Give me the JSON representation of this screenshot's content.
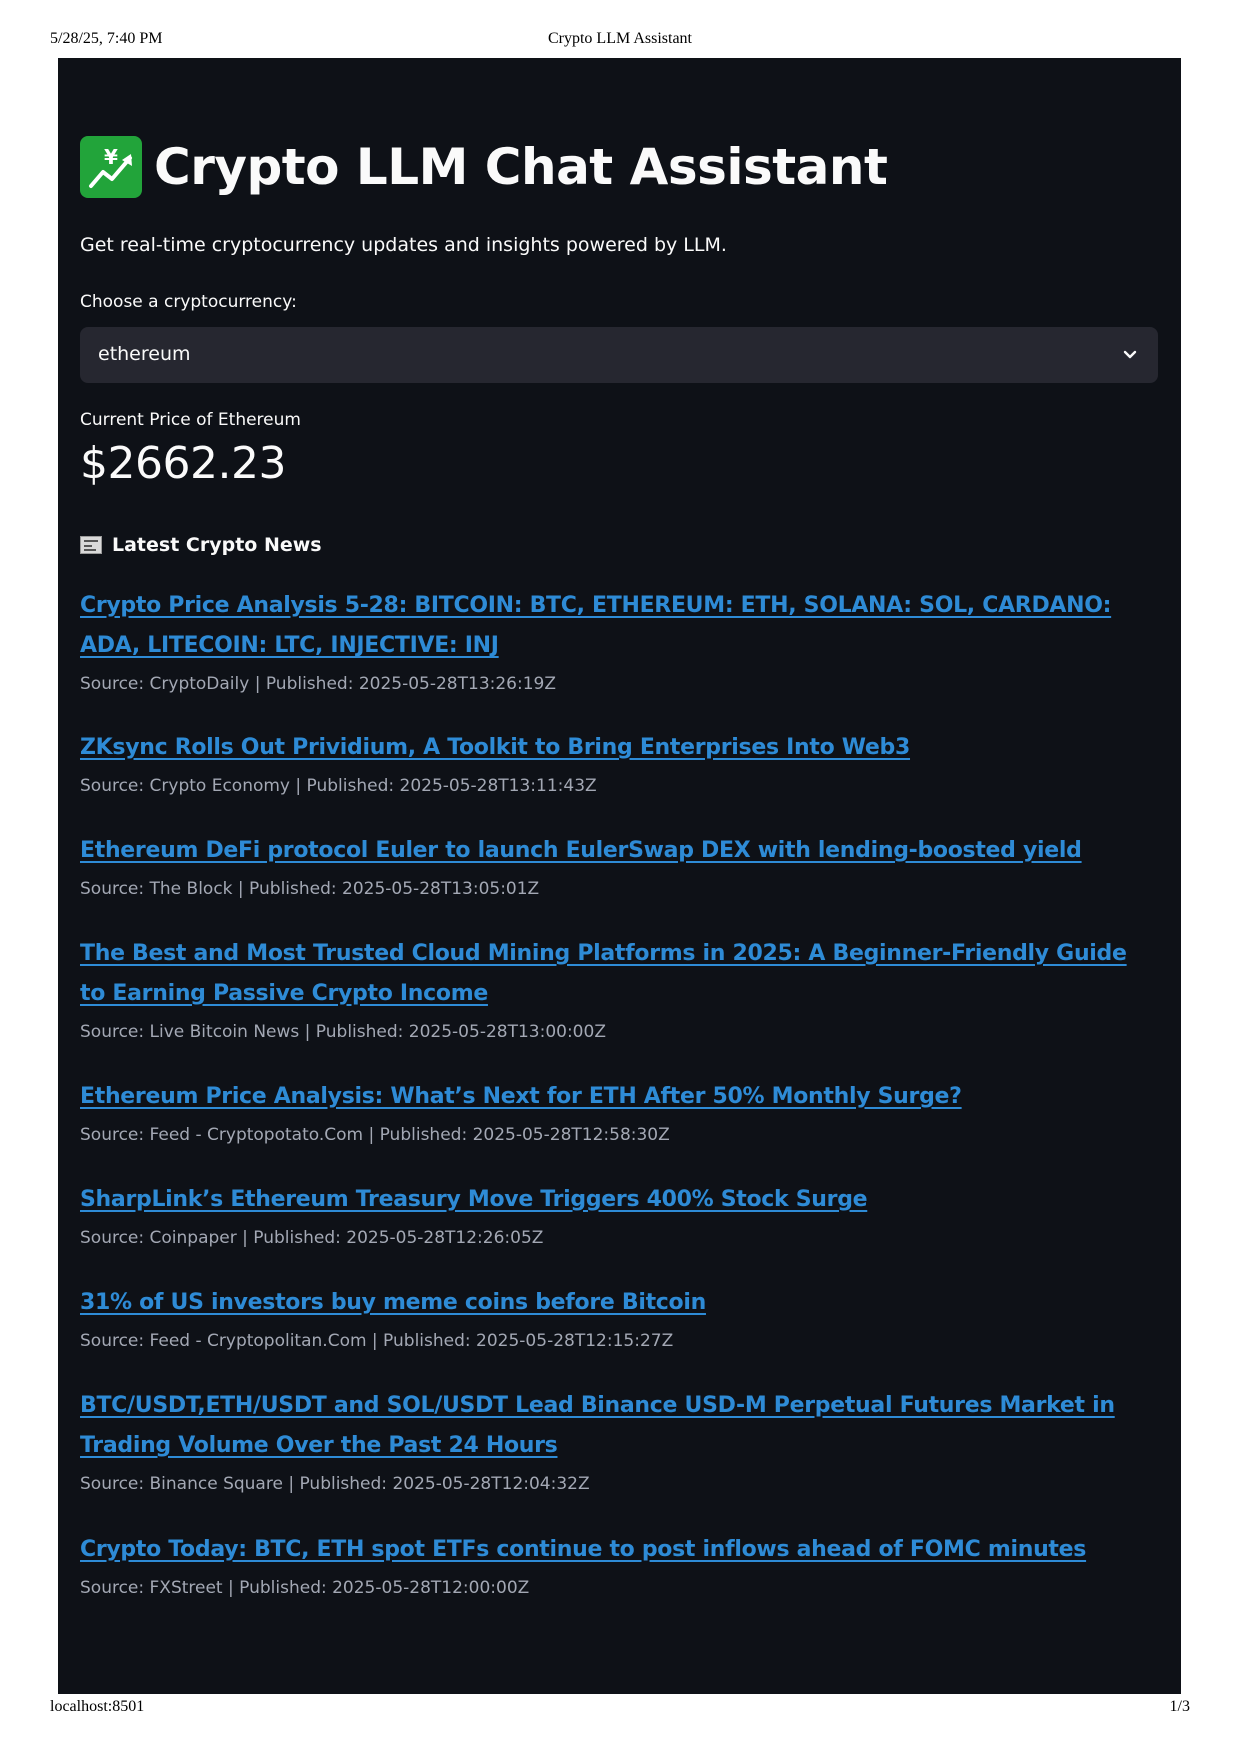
{
  "print": {
    "datetime": "5/28/25, 7:40 PM",
    "doc_title": "Crypto LLM Assistant",
    "url": "localhost:8501",
    "page": "1/3"
  },
  "app": {
    "title_icon": "chart-increasing-yen-icon",
    "title": "Crypto LLM Chat Assistant",
    "subtitle": "Get real-time cryptocurrency updates and insights powered by LLM.",
    "select": {
      "label": "Choose a cryptocurrency:",
      "value": "ethereum"
    },
    "metric": {
      "label": "Current Price of Ethereum",
      "value": "$2662.23"
    },
    "news": {
      "icon": "newspaper-icon",
      "heading": "Latest Crypto News",
      "items": [
        {
          "title": "Crypto Price Analysis 5-28: BITCOIN: BTC, ETHEREUM: ETH, SOLANA: SOL, CARDANO: ADA, LITECOIN: LTC, INJECTIVE: INJ",
          "meta": "Source: CryptoDaily | Published: 2025-05-28T13:26:19Z"
        },
        {
          "title": "ZKsync Rolls Out Prividium, A Toolkit to Bring Enterprises Into Web3",
          "meta": "Source: Crypto Economy | Published: 2025-05-28T13:11:43Z"
        },
        {
          "title": "Ethereum DeFi protocol Euler to launch EulerSwap DEX with lending-boosted yield",
          "meta": "Source: The Block | Published: 2025-05-28T13:05:01Z"
        },
        {
          "title": "The Best and Most Trusted Cloud Mining Platforms in 2025: A Beginner-Friendly Guide to Earning Passive Crypto Income",
          "meta": "Source: Live Bitcoin News | Published: 2025-05-28T13:00:00Z"
        },
        {
          "title": "Ethereum Price Analysis: What’s Next for ETH After 50% Monthly Surge?",
          "meta": "Source: Feed - Cryptopotato.Com | Published: 2025-05-28T12:58:30Z"
        },
        {
          "title": "SharpLink’s Ethereum Treasury Move Triggers 400% Stock Surge",
          "meta": "Source: Coinpaper | Published: 2025-05-28T12:26:05Z"
        },
        {
          "title": "31% of US investors buy meme coins before Bitcoin",
          "meta": "Source: Feed - Cryptopolitan.Com | Published: 2025-05-28T12:15:27Z"
        },
        {
          "title": "BTC/USDT,ETH/USDT and SOL/USDT Lead Binance USD-M Perpetual Futures Market in Trading Volume Over the Past 24 Hours",
          "meta": "Source: Binance Square | Published: 2025-05-28T12:04:32Z"
        },
        {
          "title": "Crypto Today: BTC, ETH spot ETFs continue to post inflows ahead of FOMC minutes",
          "meta": "Source: FXStreet | Published: 2025-05-28T12:00:00Z"
        }
      ]
    }
  },
  "colors": {
    "app_background": "#0e1117",
    "select_background": "#262730",
    "link": "#2e8bd6",
    "meta_text": "#a3a8b4",
    "text": "#fafafa"
  }
}
